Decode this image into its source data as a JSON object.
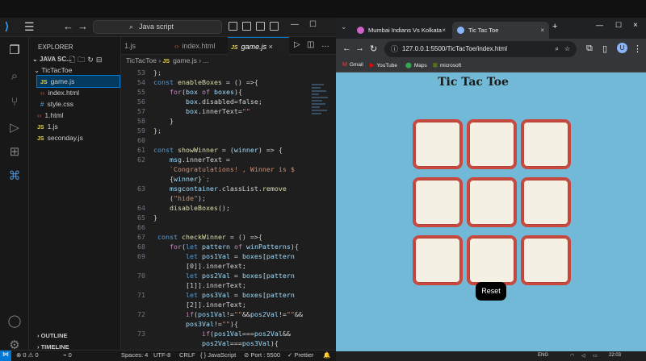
{
  "vscode": {
    "search_text": "Java script",
    "explorer_title": "EXPLORER",
    "project": "JAVA SC...",
    "files": [
      {
        "name": "TicTacToe",
        "type": "folder"
      },
      {
        "name": "game.js",
        "type": "js"
      },
      {
        "name": "index.html",
        "type": "html"
      },
      {
        "name": "style.css",
        "type": "css"
      },
      {
        "name": "1.html",
        "type": "html"
      },
      {
        "name": "1.js",
        "type": "js"
      },
      {
        "name": "seconday.js",
        "type": "js"
      }
    ],
    "outline": "OUTLINE",
    "timeline": "TIMELINE",
    "tabs": [
      "1.js",
      "index.html",
      "game.js"
    ],
    "breadcrumb": [
      "TicTacToe",
      "game.js",
      "..."
    ],
    "status": {
      "errors": "0",
      "warnings": "0",
      "ports": "0",
      "spaces": "Spaces: 4",
      "encoding": "UTF-8",
      "eol": "CRLF",
      "language": "JavaScript",
      "port": "Port : 5500",
      "prettier": "Prettier"
    },
    "code_lines": [
      {
        "n": "53",
        "t": "};"
      },
      {
        "n": "54",
        "t": "const enableBoxes = () =>{"
      },
      {
        "n": "55",
        "t": "    for(box of boxes){"
      },
      {
        "n": "56",
        "t": "        box.disabled=false;"
      },
      {
        "n": "57",
        "t": "        box.innerText=\"\""
      },
      {
        "n": "58",
        "t": "    }"
      },
      {
        "n": "59",
        "t": "};"
      },
      {
        "n": "60",
        "t": ""
      },
      {
        "n": "61",
        "t": "const showWinner = (winner) => {"
      },
      {
        "n": "62",
        "t": "    msg.innerText ="
      },
      {
        "n": "",
        "t": "    `Congratulations! , Winner is $"
      },
      {
        "n": "",
        "t": "    {winner}`;"
      },
      {
        "n": "63",
        "t": "    msgcontainer.classList.remove"
      },
      {
        "n": "",
        "t": "    (\"hide\");"
      },
      {
        "n": "64",
        "t": "    disableBoxes();"
      },
      {
        "n": "65",
        "t": "}"
      },
      {
        "n": "66",
        "t": ""
      },
      {
        "n": "67",
        "t": " const checkWinner = () =>{"
      },
      {
        "n": "68",
        "t": "    for(let pattern of winPatterns){"
      },
      {
        "n": "69",
        "t": "        let pos1Val = boxes[pattern"
      },
      {
        "n": "",
        "t": "        [0]].innerText;"
      },
      {
        "n": "70",
        "t": "        let pos2Val = boxes[pattern"
      },
      {
        "n": "",
        "t": "        [1]].innerText;"
      },
      {
        "n": "71",
        "t": "        let pos3Val = boxes[pattern"
      },
      {
        "n": "",
        "t": "        [2]].innerText;"
      },
      {
        "n": "72",
        "t": "        if(pos1Val!=\"\"&&pos2Val!=\"\"&&"
      },
      {
        "n": "",
        "t": "        pos3Val!=\"\"){"
      },
      {
        "n": "73",
        "t": "            if(pos1Val===pos2Val&&"
      },
      {
        "n": "",
        "t": "            pos2Val===pos3Val){"
      }
    ]
  },
  "chrome": {
    "tab1": "Mumbai Indians Vs Kolkata",
    "tab2": "Tic Tac Toe",
    "url": "127.0.0.1:5500/TicTacToe/index.html",
    "bookmarks": [
      "Gmail",
      "YouTube",
      "Maps",
      "microsoft"
    ],
    "profile_initial": "U",
    "game": {
      "title": "Tic Tac Toe",
      "cells": [
        "",
        "",
        "",
        "",
        "",
        "",
        "",
        "",
        ""
      ],
      "reset_label": "Reset"
    },
    "taskbar": {
      "lang": "ENG",
      "time": "22:03"
    }
  },
  "colors": {
    "page_bg": "#71b9d7",
    "cell_border": "#c9473d",
    "cell_bg": "#f4f0e4",
    "reset_bg": "#000000",
    "vscode_accent": "#0078d4"
  }
}
